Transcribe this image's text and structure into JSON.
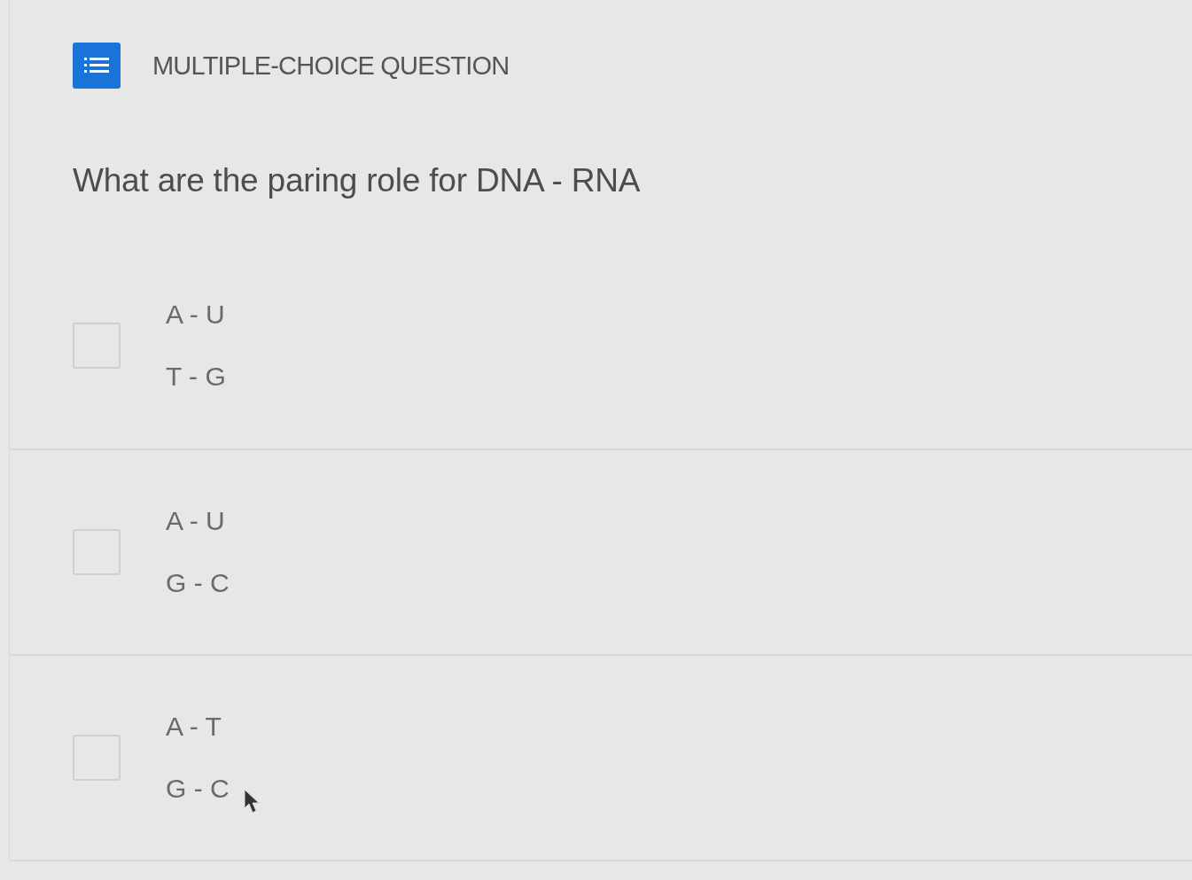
{
  "header": {
    "title": "MULTIPLE-CHOICE QUESTION"
  },
  "question": "What are the paring role for DNA - RNA",
  "options": [
    {
      "lines": [
        "A - U",
        "T - G"
      ],
      "checked": false
    },
    {
      "lines": [
        "A - U",
        "G - C"
      ],
      "checked": false
    },
    {
      "lines": [
        "A - T",
        "G - C"
      ],
      "checked": false
    }
  ]
}
